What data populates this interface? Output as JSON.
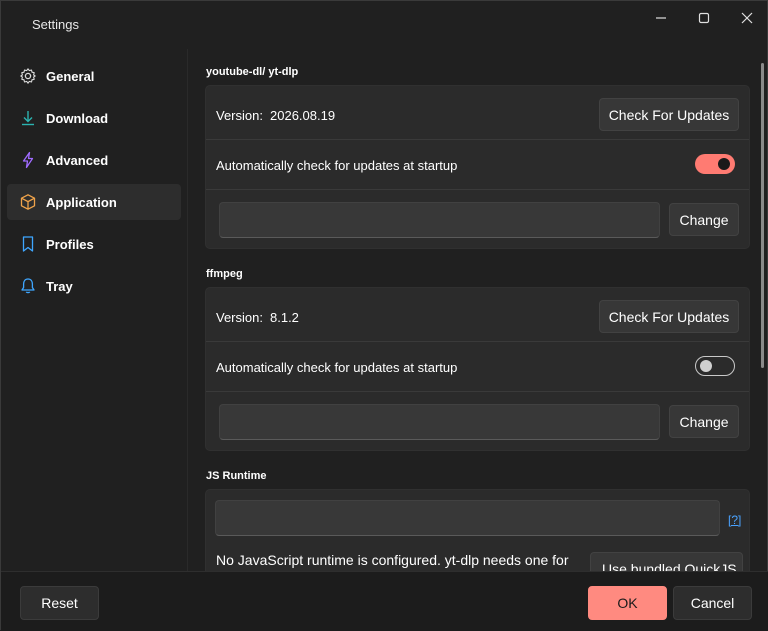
{
  "window": {
    "title": "Settings",
    "minimize_glyph": "—",
    "maximize_glyph": "☐",
    "close_glyph": "✕"
  },
  "sidebar": {
    "items": [
      {
        "label": "General",
        "icon": "gear-icon",
        "active": false
      },
      {
        "label": "Download",
        "icon": "download-icon",
        "active": false
      },
      {
        "label": "Advanced",
        "icon": "lightning-icon",
        "active": false
      },
      {
        "label": "Application",
        "icon": "box-icon",
        "active": true
      },
      {
        "label": "Profiles",
        "icon": "bookmark-icon",
        "active": false
      },
      {
        "label": "Tray",
        "icon": "bell-icon",
        "active": false
      }
    ]
  },
  "sections": {
    "ytdlp": {
      "title": "youtube-dl/ yt-dlp",
      "version_label": "Version:",
      "version_value": "2026.08.19",
      "check_updates_label": "Check For Updates",
      "auto_check_label": "Automatically check for updates at startup",
      "auto_check_enabled": true,
      "path_value": "",
      "change_label": "Change"
    },
    "ffmpeg": {
      "title": "ffmpeg",
      "version_label": "Version:",
      "version_value": "8.1.2",
      "check_updates_label": "Check For Updates",
      "auto_check_label": "Automatically check for updates at startup",
      "auto_check_enabled": false,
      "path_value": "",
      "change_label": "Change"
    },
    "js_runtime": {
      "title": "JS Runtime",
      "path_value": "",
      "help_label": "[?]",
      "message": "No JavaScript runtime is configured. yt-dlp needs one for",
      "bundled_button_label": "Use bundled QuickJS"
    }
  },
  "footer": {
    "reset_label": "Reset",
    "ok_label": "OK",
    "cancel_label": "Cancel"
  },
  "colors": {
    "accent": "#ff8a80",
    "toggle_on": "#ff7b72",
    "background": "#202020",
    "card": "#2b2b2b"
  }
}
